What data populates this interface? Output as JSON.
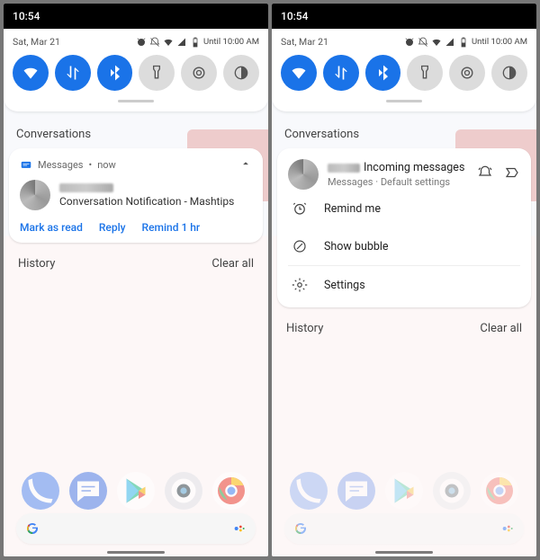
{
  "statusbar": {
    "time": "10:54"
  },
  "shade": {
    "date": "Sat, Mar 21",
    "status_until": "Until 10:00 AM",
    "qs": [
      {
        "name": "wifi",
        "on": true
      },
      {
        "name": "data",
        "on": true
      },
      {
        "name": "bluetooth",
        "on": true
      },
      {
        "name": "flashlight",
        "on": false
      },
      {
        "name": "nfc",
        "on": false
      },
      {
        "name": "dark",
        "on": false
      }
    ]
  },
  "sections": {
    "conversations_label": "Conversations",
    "history_label": "History",
    "clear_all": "Clear all"
  },
  "left": {
    "notif": {
      "app": "Messages",
      "age": "now",
      "body": "Conversation Notification - Mashtips"
    },
    "actions": {
      "mark_read": "Mark as read",
      "reply": "Reply",
      "remind": "Remind 1 hr"
    }
  },
  "right": {
    "head": {
      "title_suffix": "Incoming messages",
      "subtitle_app": "Messages",
      "subtitle_dot": " · ",
      "subtitle_setting": "Default settings"
    },
    "menu": {
      "remind": "Remind me",
      "bubble": "Show bubble",
      "settings": "Settings"
    }
  }
}
